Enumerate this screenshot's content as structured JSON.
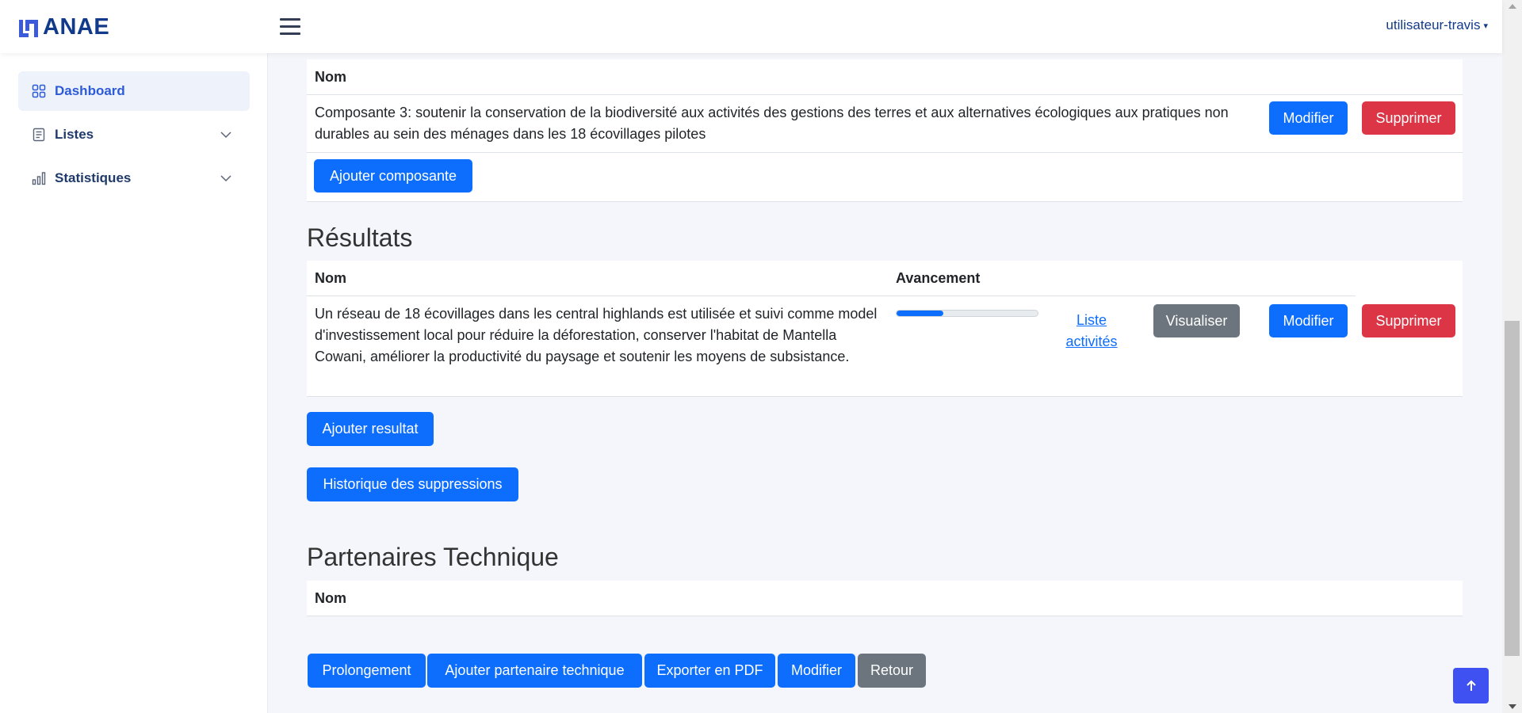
{
  "header": {
    "brand": "ANAE",
    "user_label": "utilisateur-travis"
  },
  "sidebar": {
    "items": [
      {
        "label": "Dashboard",
        "icon": "grid-icon"
      },
      {
        "label": "Listes",
        "icon": "list-icon"
      },
      {
        "label": "Statistiques",
        "icon": "bar-chart-icon"
      }
    ]
  },
  "composantes": {
    "col_nom": "Nom",
    "row_text": "Composante 3: soutenir la conservation de la biodiversité aux activités des gestions des terres et aux alternatives écologiques aux pratiques non durables au sein des ménages dans les 18 écovillages pilotes",
    "modifier": "Modifier",
    "supprimer": "Supprimer",
    "add_button": "Ajouter composante"
  },
  "resultats": {
    "title": "Résultats",
    "col_nom": "Nom",
    "col_avancement": "Avancement",
    "row_text": "Un réseau de 18 écovillages dans les central highlands est utilisée et suivi comme model d'investissement local pour réduire la déforestation, conserver l'habitat de Mantella Cowani, améliorer la productivité du paysage et soutenir les moyens de subsistance.",
    "progress_percent": 33,
    "link_activities": "Liste activités",
    "visualiser": "Visualiser",
    "modifier": "Modifier",
    "supprimer": "Supprimer",
    "add_button": "Ajouter resultat",
    "history_button": "Historique des suppressions"
  },
  "partenaires": {
    "title": "Partenaires Technique",
    "col_nom": "Nom"
  },
  "footer_actions": {
    "prolongement": "Prolongement",
    "ajouter_partenaire": "Ajouter partenaire technique",
    "exporter_pdf": "Exporter en PDF",
    "modifier": "Modifier",
    "retour": "Retour"
  },
  "colors": {
    "primary": "#0d6efd",
    "danger": "#dc3545",
    "secondary": "#6c757d",
    "brand": "#123a8a",
    "back_to_top": "#3f51f0"
  }
}
